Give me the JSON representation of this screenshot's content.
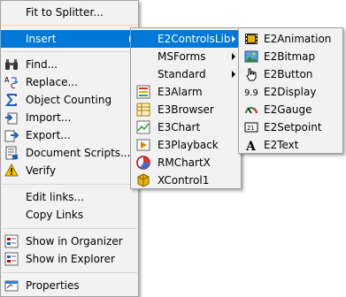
{
  "main_menu": {
    "fit_to_splitter": "Fit to Splitter...",
    "insert": "Insert",
    "find": "Find...",
    "replace": "Replace...",
    "object_counting": "Object Counting",
    "import": "Import...",
    "export": "Export...",
    "document_scripts": "Document Scripts...",
    "verify": "Verify",
    "edit_links": "Edit links...",
    "copy_links": "Copy Links",
    "show_in_organizer": "Show in Organizer",
    "show_in_explorer": "Show in Explorer",
    "properties": "Properties"
  },
  "insert_menu": {
    "e2controlslib": "E2ControlsLib",
    "msforms": "MSForms",
    "standard": "Standard",
    "e3alarm": "E3Alarm",
    "e3browser": "E3Browser",
    "e3chart": "E3Chart",
    "e3playback": "E3Playback",
    "rmchartx": "RMChartX",
    "xcontrol1": "XControl1"
  },
  "e2_menu": {
    "e2animation": "E2Animation",
    "e2bitmap": "E2Bitmap",
    "e2button": "E2Button",
    "e2display": "E2Display",
    "e2gauge": "E2Gauge",
    "e2setpoint": "E2Setpoint",
    "e2text": "E2Text"
  },
  "colors": {
    "highlight": "#0078d7",
    "menu_bg": "#f2f2f2"
  }
}
